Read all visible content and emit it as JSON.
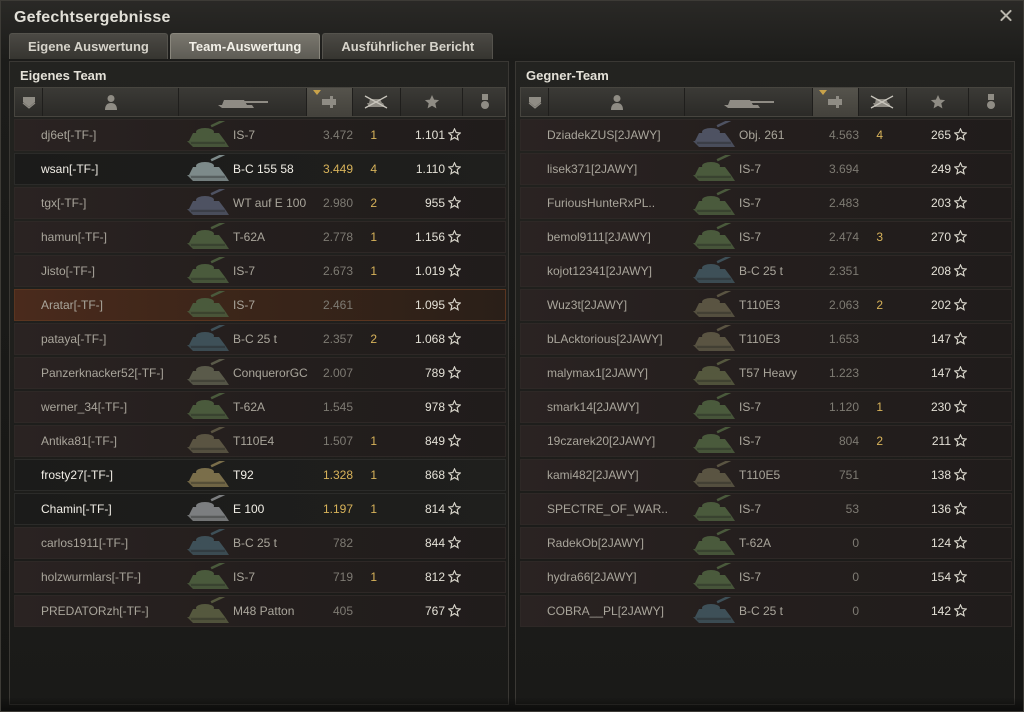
{
  "window": {
    "title": "Gefechtsergebnisse"
  },
  "tabs": [
    {
      "label": "Eigene Auswertung",
      "active": false
    },
    {
      "label": "Team-Auswertung",
      "active": true
    },
    {
      "label": "Ausführlicher Bericht",
      "active": false
    }
  ],
  "colors": {
    "accent_gold": "#d8b35a",
    "highlight_row": "#4a2a1c",
    "active_tab": "#7a776e"
  },
  "columns": [
    "squad-icon",
    "player-icon",
    "tank-icon",
    "xp-icon",
    "kills-icon",
    "star-icon",
    "medal-icon"
  ],
  "sorted_column": "xp-icon",
  "own_team": {
    "title": "Eigenes Team",
    "rows": [
      {
        "player": "dj6et[-TF-]",
        "tank": "IS-7",
        "xp": "3.472",
        "kills": "1",
        "damage": "1.101",
        "state": "dim",
        "tank_color": "#4a5a3c"
      },
      {
        "player": "wsan[-TF-]",
        "tank": "B-C 155 58",
        "xp": "3.449",
        "kills": "4",
        "damage": "1.110",
        "state": "bright",
        "tank_color": "#7d8a8a"
      },
      {
        "player": "tgx[-TF-]",
        "tank": "WT auf E 100",
        "xp": "2.980",
        "kills": "2",
        "damage": "955",
        "state": "dim",
        "tank_color": "#4e5262"
      },
      {
        "player": "hamun[-TF-]",
        "tank": "T-62A",
        "xp": "2.778",
        "kills": "1",
        "damage": "1.156",
        "state": "dim",
        "tank_color": "#4a5a3c"
      },
      {
        "player": "Jisto[-TF-]",
        "tank": "IS-7",
        "xp": "2.673",
        "kills": "1",
        "damage": "1.019",
        "state": "dim",
        "tank_color": "#4a5a3c"
      },
      {
        "player": "Aratar[-TF-]",
        "tank": "IS-7",
        "xp": "2.461",
        "kills": "",
        "damage": "1.095",
        "state": "highlight",
        "tank_color": "#4a5a3c"
      },
      {
        "player": "pataya[-TF-]",
        "tank": "B-C 25 t",
        "xp": "2.357",
        "kills": "2",
        "damage": "1.068",
        "state": "dim",
        "tank_color": "#3e5058"
      },
      {
        "player": "Panzerknacker52[-TF-]",
        "tank": "ConquerorGC",
        "xp": "2.007",
        "kills": "",
        "damage": "789",
        "state": "dim",
        "tank_color": "#5a5a4a"
      },
      {
        "player": "werner_34[-TF-]",
        "tank": "T-62A",
        "xp": "1.545",
        "kills": "",
        "damage": "978",
        "state": "dim",
        "tank_color": "#4a5a3c"
      },
      {
        "player": "Antika81[-TF-]",
        "tank": "T110E4",
        "xp": "1.507",
        "kills": "1",
        "damage": "849",
        "state": "dim",
        "tank_color": "#5a5442"
      },
      {
        "player": "frosty27[-TF-]",
        "tank": "T92",
        "xp": "1.328",
        "kills": "1",
        "damage": "868",
        "state": "bright",
        "tank_color": "#7a6e4a"
      },
      {
        "player": "Chamin[-TF-]",
        "tank": "E 100",
        "xp": "1.197",
        "kills": "1",
        "damage": "814",
        "state": "bright",
        "tank_color": "#7c7e80"
      },
      {
        "player": "carlos1911[-TF-]",
        "tank": "B-C 25 t",
        "xp": "782",
        "kills": "",
        "damage": "844",
        "state": "dim",
        "tank_color": "#3e5058"
      },
      {
        "player": "holzwurmlars[-TF-]",
        "tank": "IS-7",
        "xp": "719",
        "kills": "1",
        "damage": "812",
        "state": "dim",
        "tank_color": "#4a5a3c"
      },
      {
        "player": "PREDATORzh[-TF-]",
        "tank": "M48 Patton",
        "xp": "405",
        "kills": "",
        "damage": "767",
        "state": "dim",
        "tank_color": "#55583e"
      }
    ]
  },
  "enemy_team": {
    "title": "Gegner-Team",
    "rows": [
      {
        "player": "DziadekZUS[2JAWY]",
        "tank": "Obj. 261",
        "xp": "4.563",
        "kills": "4",
        "damage": "265",
        "state": "dim",
        "tank_color": "#4e5262"
      },
      {
        "player": "lisek371[2JAWY]",
        "tank": "IS-7",
        "xp": "3.694",
        "kills": "",
        "damage": "249",
        "state": "dim",
        "tank_color": "#4a5a3c"
      },
      {
        "player": "FuriousHunteRxPL..",
        "tank": "IS-7",
        "xp": "2.483",
        "kills": "",
        "damage": "203",
        "state": "dim",
        "tank_color": "#4a5a3c"
      },
      {
        "player": "bemol9111[2JAWY]",
        "tank": "IS-7",
        "xp": "2.474",
        "kills": "3",
        "damage": "270",
        "state": "dim",
        "tank_color": "#4a5a3c"
      },
      {
        "player": "kojot12341[2JAWY]",
        "tank": "B-C 25 t",
        "xp": "2.351",
        "kills": "",
        "damage": "208",
        "state": "dim",
        "tank_color": "#3e5058"
      },
      {
        "player": "Wuz3t[2JAWY]",
        "tank": "T110E3",
        "xp": "2.063",
        "kills": "2",
        "damage": "202",
        "state": "dim",
        "tank_color": "#5a5442"
      },
      {
        "player": "bLAcktorious[2JAWY]",
        "tank": "T110E3",
        "xp": "1.653",
        "kills": "",
        "damage": "147",
        "state": "dim",
        "tank_color": "#5a5442"
      },
      {
        "player": "malymax1[2JAWY]",
        "tank": "T57 Heavy",
        "xp": "1.223",
        "kills": "",
        "damage": "147",
        "state": "dim",
        "tank_color": "#55583e"
      },
      {
        "player": "smark14[2JAWY]",
        "tank": "IS-7",
        "xp": "1.120",
        "kills": "1",
        "damage": "230",
        "state": "dim",
        "tank_color": "#4a5a3c"
      },
      {
        "player": "19czarek20[2JAWY]",
        "tank": "IS-7",
        "xp": "804",
        "kills": "2",
        "damage": "211",
        "state": "dim",
        "tank_color": "#4a5a3c"
      },
      {
        "player": "kami482[2JAWY]",
        "tank": "T110E5",
        "xp": "751",
        "kills": "",
        "damage": "138",
        "state": "dim",
        "tank_color": "#5a5442"
      },
      {
        "player": "SPECTRE_OF_WAR..",
        "tank": "IS-7",
        "xp": "53",
        "kills": "",
        "damage": "136",
        "state": "dim",
        "tank_color": "#4a5a3c"
      },
      {
        "player": "RadekOb[2JAWY]",
        "tank": "T-62A",
        "xp": "0",
        "kills": "",
        "damage": "124",
        "state": "dim",
        "tank_color": "#4a5a3c"
      },
      {
        "player": "hydra66[2JAWY]",
        "tank": "IS-7",
        "xp": "0",
        "kills": "",
        "damage": "154",
        "state": "dim",
        "tank_color": "#4a5a3c"
      },
      {
        "player": "COBRA__PL[2JAWY]",
        "tank": "B-C 25 t",
        "xp": "0",
        "kills": "",
        "damage": "142",
        "state": "dim",
        "tank_color": "#3e5058"
      }
    ]
  }
}
